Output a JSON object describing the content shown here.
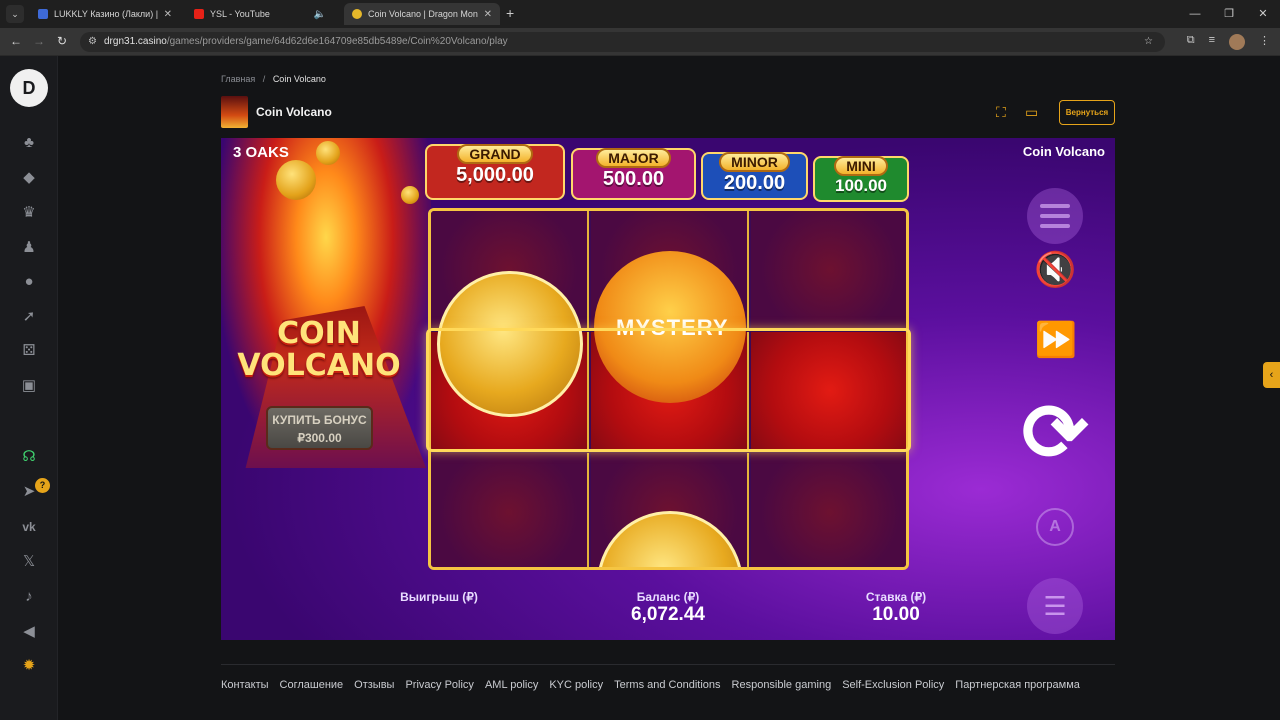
{
  "browser": {
    "tabs": [
      {
        "title": "LUKKLY Казино (Лакли) | Офиц",
        "fav_color": "#3e6ad8"
      },
      {
        "title": "YSL - YouTube",
        "fav_color": "#e62117"
      },
      {
        "title": "Coin Volcano | Dragon Money",
        "fav_color": "#e6b82a"
      }
    ],
    "url_host": "drgn31.casino",
    "url_path": "/games/providers/game/64d62d6e164709e85db5489e/Coin%20Volcano/play"
  },
  "breadcrumb": {
    "home": "Главная",
    "sep": "/",
    "current": "Coin Volcano"
  },
  "game_header": {
    "title": "Coin Volcano",
    "back_label": "Вернуться"
  },
  "game": {
    "provider": "3 OAKS",
    "name_label": "Coin Volcano",
    "logo_line1": "COIN",
    "logo_line2": "VOLCANO",
    "buy_bonus_line1": "КУПИТЬ БОНУС",
    "buy_bonus_line2": "₽300.00",
    "jackpots": [
      {
        "name": "GRAND",
        "value": "5,000.00",
        "color": "#c2271f"
      },
      {
        "name": "MAJOR",
        "value": "500.00",
        "color": "#a3156f"
      },
      {
        "name": "MINOR",
        "value": "200.00",
        "color": "#1d4fb8"
      },
      {
        "name": "MINI",
        "value": "100.00",
        "color": "#1f8a2e"
      }
    ],
    "mystery_text": "MYSTERY",
    "win_label": "Выигрыш (₽)",
    "balance_label": "Баланс (₽)",
    "balance_value": "6,072.44",
    "bet_label": "Ставка (₽)",
    "bet_value": "10.00"
  },
  "footer": {
    "links": [
      "Контакты",
      "Соглашение",
      "Отзывы",
      "Privacy Policy",
      "AML policy",
      "KYC policy",
      "Terms and Conditions",
      "Responsible gaming",
      "Self-Exclusion Policy",
      "Партнерская программа"
    ]
  },
  "sidebar_badge": "?",
  "colors": {
    "accent": "#e6a41a"
  }
}
